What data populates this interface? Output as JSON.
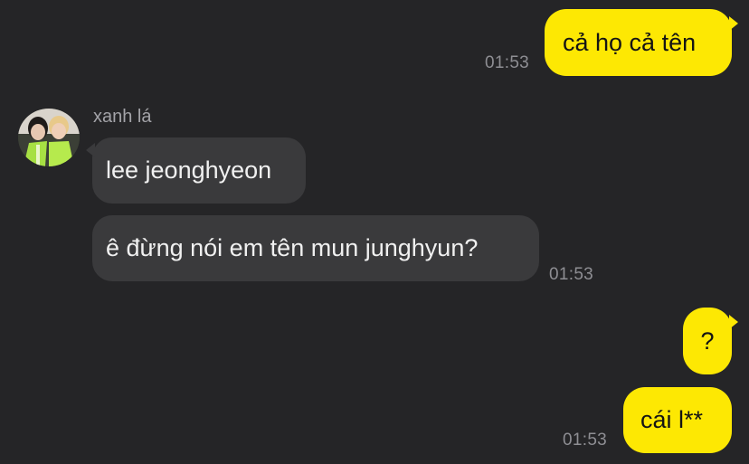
{
  "messages": {
    "m1": {
      "text": "cả họ cả tên",
      "time": "01:53"
    },
    "sender_name": "xanh lá",
    "m2": {
      "text": "lee jeonghyeon"
    },
    "m3": {
      "text": "ê đừng nói em tên mun junghyun?",
      "time": "01:53"
    },
    "m4": {
      "text": "?"
    },
    "m5": {
      "text": "cái l**",
      "time": "01:53"
    }
  },
  "colors": {
    "background": "#252527",
    "outgoing_bubble": "#fde803",
    "incoming_bubble": "#3a3a3c",
    "timestamp": "#8e8e93"
  },
  "icons": {
    "avatar": "profile-photo-avatar"
  }
}
